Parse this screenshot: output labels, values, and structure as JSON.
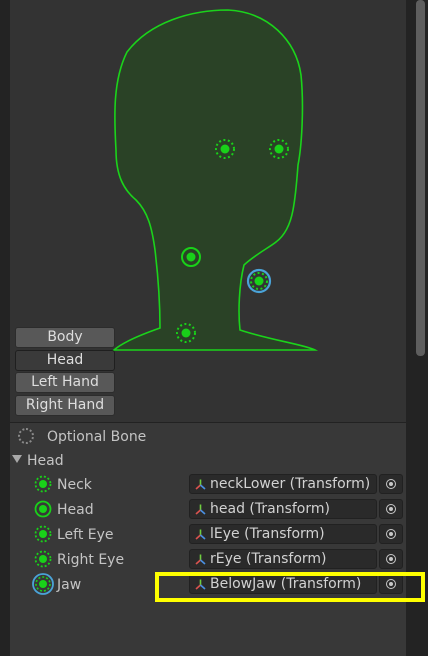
{
  "body_parts": [
    {
      "label": "Body",
      "active": false
    },
    {
      "label": "Head",
      "active": true
    },
    {
      "label": "Left Hand",
      "active": false
    },
    {
      "label": "Right Hand",
      "active": false
    }
  ],
  "legend": {
    "label": "Optional Bone"
  },
  "group": {
    "label": "Head",
    "expanded": true
  },
  "bones": [
    {
      "label": "Neck",
      "value": "neckLower (Transform)",
      "optional": true
    },
    {
      "label": "Head",
      "value": "head (Transform)",
      "optional": false
    },
    {
      "label": "Left Eye",
      "value": "lEye (Transform)",
      "optional": true
    },
    {
      "label": "Right Eye",
      "value": "rEye (Transform)",
      "optional": true
    },
    {
      "label": "Jaw",
      "value": "BelowJaw (Transform)",
      "optional": true,
      "selected": true
    }
  ],
  "colors": {
    "bone_green": "#19d119",
    "selected_ring": "#4aa3d8",
    "head_fill": "#2a4226",
    "head_outline": "#1bd31b",
    "highlight": "#ffff00"
  }
}
